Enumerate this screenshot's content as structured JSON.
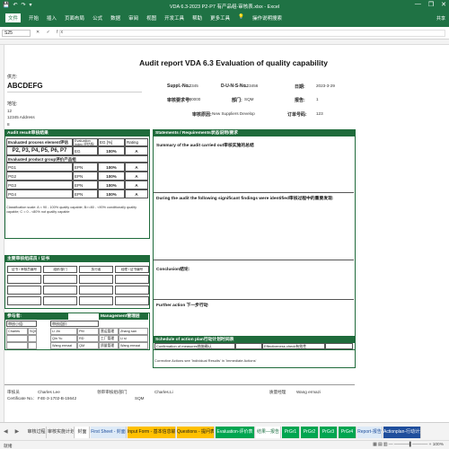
{
  "window": {
    "title": "VDA 6.3-2023 P2-P7 有产品组-审核表.xlsx  -  Excel",
    "quick_access": [
      "💾",
      "↶",
      "↷",
      "▾"
    ],
    "controls": [
      "—",
      "❐",
      "✕"
    ]
  },
  "ribbon": {
    "tabs": [
      "文件",
      "开始",
      "插入",
      "页面布局",
      "公式",
      "数据",
      "审阅",
      "视图",
      "开发工具",
      "帮助",
      "更多工具",
      "💡",
      "操作说明搜索"
    ],
    "active_tab": 0,
    "share": "共享"
  },
  "formula_bar": {
    "name_box": "S25",
    "fx": "✕ ✓ fx",
    "content": ""
  },
  "report": {
    "title": "Audit report VDA 6.3 Evaluation of quality capability",
    "supplier_label": "供方:",
    "supplier_name": "ABCDEFG",
    "address_label": "地址:",
    "address_lines": [
      "12",
      "12345 Address",
      "8"
    ],
    "supplier_no_label": "Suppl.-No.:",
    "supplier_no": "12345",
    "duns_label": "D-U-N-S-No.:",
    "duns": "123456",
    "date_label": "日期:",
    "date": "2023-3-29",
    "order_no_label": "审核要求号:",
    "order_no": "000000",
    "dept_label": "部门:",
    "dept": "SQM",
    "report_no_label": "报告:",
    "report_no": "1",
    "reason_label": "审核原因:",
    "reason": "New Suppliers Develop",
    "order_label": "订单号码:",
    "order": "123"
  },
  "audit_result": {
    "header": "Audit result审核结果",
    "col_process": "Evaluated process element评估过程要素",
    "col_index": "Evaluation index 评估指标",
    "col_eg": "EG [%]",
    "col_rating": "Rating",
    "p_row_label": "P2, P3, P4, P5, P6, P7",
    "p_row_index": "EG",
    "p_row_eg": "100%",
    "p_row_rating": "A",
    "group_label": "Evaluated product group评价产品组",
    "groups": [
      {
        "name": "PG1",
        "index": "EPN",
        "eg": "100%",
        "rating": "A"
      },
      {
        "name": "PG2",
        "index": "EPN",
        "eg": "100%",
        "rating": "A"
      },
      {
        "name": "PG3",
        "index": "EPN",
        "eg": "100%",
        "rating": "A"
      },
      {
        "name": "PG4",
        "index": "EPN",
        "eg": "100%",
        "rating": "A"
      }
    ],
    "classification": "Classification scale: A = 90 - 100% quality capable; B>=80 - <90% conditionally quality capable; C = 0 - <80% not quality capable"
  },
  "statements": {
    "header": "Statements / Requirements状态说明/要求",
    "summary": "Summary of the audit carried out审核实施的总结",
    "findings": "During the audit the following significant findings were identified审核过程中的重要发现:",
    "conclusion": "Conclusion结论:",
    "further": "Further action 下一步行动"
  },
  "auditors": {
    "header": "主要审核组成员 / 证书",
    "cols": [
      "证书 / 审核员编号",
      "组织/部门",
      "执行者",
      "经理 / 证书编号"
    ]
  },
  "participants": {
    "header": "参与者:",
    "mgmt_header": "Management管理层",
    "team_label": "审核小组:",
    "team_label2": "审核组织:",
    "rows": [
      {
        "a": "Charles Lee",
        "b": "SQM",
        "c": "Li Jin",
        "d": "PM",
        "e": "营运管理",
        "f": "Zhang san"
      },
      {
        "a": "",
        "b": "",
        "c": "Qin Yu",
        "d": "RD",
        "e": "工厂管理",
        "f": "Li si"
      },
      {
        "a": "",
        "b": "",
        "c": "Wang ermazi",
        "d": "QM",
        "e": "质量管理",
        "f": "Wang ermazi"
      }
    ]
  },
  "schedule": {
    "header": "Schedule of action plan行动计划时间表",
    "confirm_label": "Confirmation of measures措施确认",
    "effect_label": "Effectiveness check有效性",
    "note": "Corrective Actions see 'Individual Results' in 'Immediate Actions'"
  },
  "signatures": {
    "auditor_label": "审核员",
    "auditor_name": "Charles Lee",
    "cert_label": "Certificate No.:",
    "cert_no": "F4E-3-1702-B-15642",
    "lead_label": "领审审核组/部门",
    "lead_name": "Charles.Li",
    "lead_dept": "SQM",
    "mgr_label": "质量经理",
    "mgr_name": "Wang ermazi"
  },
  "sheet_tabs": [
    {
      "label": "审核过程",
      "bg": "#f3f3f3",
      "fg": "#333333"
    },
    {
      "label": "审核实施计划",
      "bg": "#f3f3f3",
      "fg": "#333333"
    },
    {
      "label": "封面",
      "bg": "#ffffff",
      "fg": "#333333"
    },
    {
      "label": "First Sheet - 封面",
      "bg": "#ddeaf7",
      "fg": "#1f4e9c"
    },
    {
      "label": "Input Form - 基本信息输入",
      "bg": "#ffc000",
      "fg": "#1a1a1a"
    },
    {
      "label": "Questions - 提问表",
      "bg": "#ffc000",
      "fg": "#1a1a1a"
    },
    {
      "label": "Evaluation-评价表",
      "bg": "#00a550",
      "fg": "#ffffff"
    },
    {
      "label": "结果—报告",
      "bg": "#ffffff",
      "fg": "#1f7244"
    },
    {
      "label": "PrGr1",
      "bg": "#00a550",
      "fg": "#ffffff"
    },
    {
      "label": "PrGr2",
      "bg": "#00a550",
      "fg": "#ffffff"
    },
    {
      "label": "PrGr3",
      "bg": "#00a550",
      "fg": "#ffffff"
    },
    {
      "label": "PrGr4",
      "bg": "#00a550",
      "fg": "#ffffff"
    },
    {
      "label": "Report-报告",
      "bg": "#ddeaf7",
      "fg": "#1f4e9c"
    },
    {
      "label": "Actionplan-行动计划",
      "bg": "#1f4e9c",
      "fg": "#ffffff"
    }
  ],
  "status": {
    "ready": "就绪",
    "zoom": "▦  ▤  ▥   —  ─────▌─────  +  100%"
  },
  "colors": {
    "excel_green": "#1f7244",
    "box_green": "#1f6b3b"
  }
}
